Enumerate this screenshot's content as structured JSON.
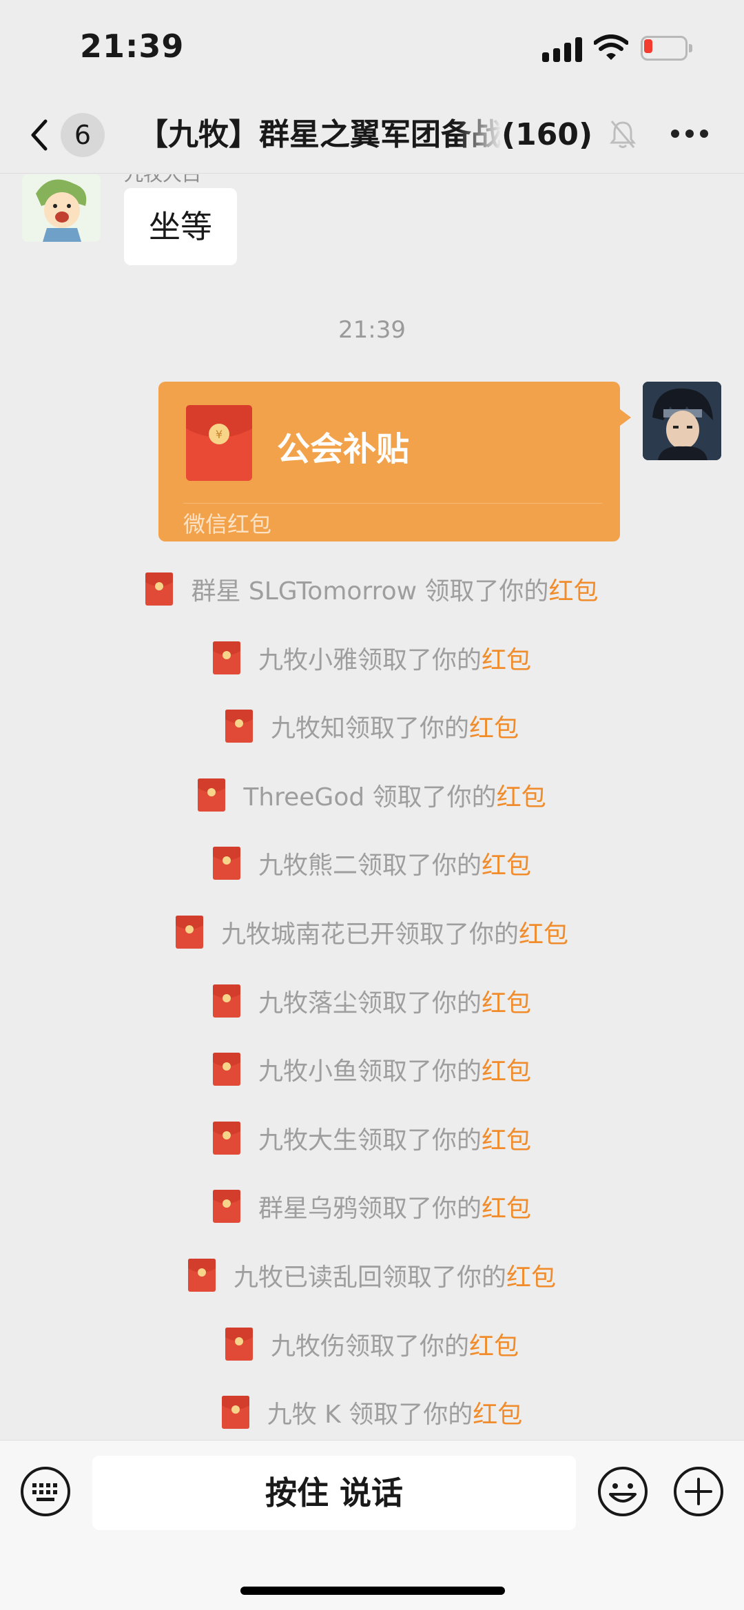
{
  "status_bar": {
    "time": "21:39",
    "icons": [
      "signal-icon",
      "wifi-icon",
      "battery-low-icon"
    ],
    "battery_color": "#f33b30"
  },
  "nav": {
    "unread_count": "6",
    "title": "【九牧】群星之翼军团备战",
    "member_count": "(160)",
    "icons": [
      "back-icon",
      "mute-icon",
      "more-icon"
    ]
  },
  "messages": {
    "sender_name": "九牧大白",
    "received_text": "坐等",
    "timestamp": "21:39",
    "red_packet": {
      "title": "公会补贴",
      "footer": "微信红包",
      "color": "#f2a24a"
    }
  },
  "notices": {
    "link_label": "红包",
    "link_color": "#f08c2b",
    "items": [
      {
        "text": "群星 SLGTomorrow 领取了你的"
      },
      {
        "text": "九牧小雅领取了你的"
      },
      {
        "text": "九牧知领取了你的"
      },
      {
        "text": "ThreeGod 领取了你的"
      },
      {
        "text": "九牧熊二领取了你的"
      },
      {
        "text": "九牧城南花已开领取了你的"
      },
      {
        "text": "九牧落尘领取了你的"
      },
      {
        "text": "九牧小鱼领取了你的"
      },
      {
        "text": "九牧大生领取了你的"
      },
      {
        "text": "群星乌鸦领取了你的"
      },
      {
        "text": "九牧已读乱回领取了你的"
      },
      {
        "text": "九牧伤领取了你的"
      },
      {
        "text": "九牧 K 领取了你的"
      }
    ]
  },
  "input_bar": {
    "voice_label": "按住 说话",
    "icons": [
      "keyboard-icon",
      "emoji-icon",
      "plus-icon"
    ]
  }
}
